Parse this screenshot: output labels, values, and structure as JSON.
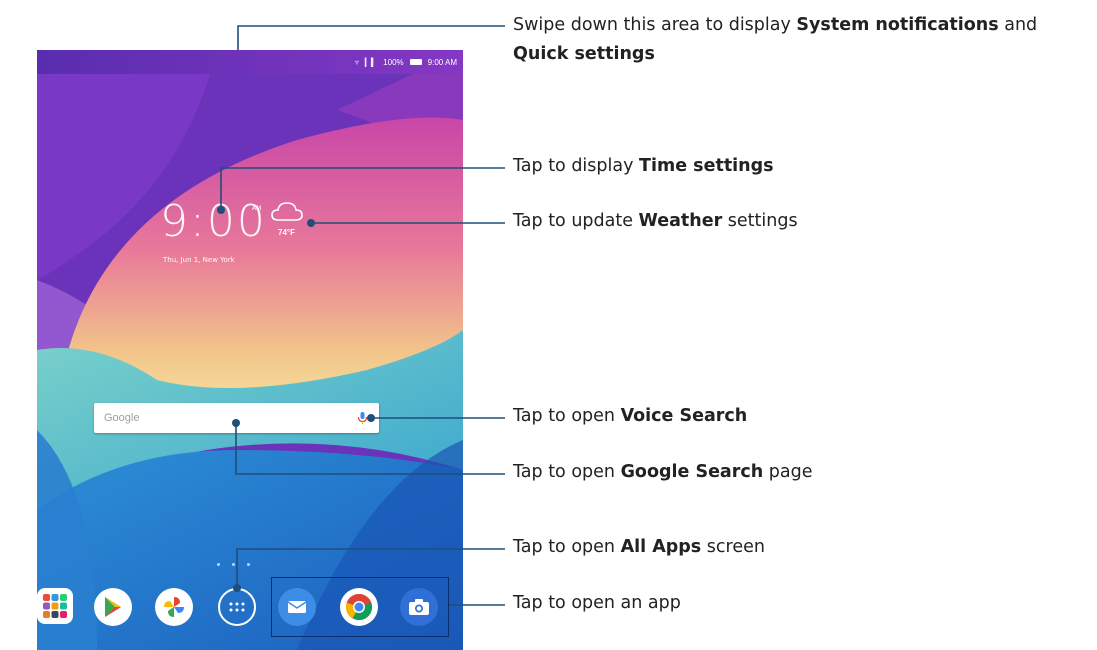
{
  "status_bar": {
    "icons": [
      "wifi-icon",
      "signal-icon",
      "battery-icon"
    ],
    "battery": "100%",
    "time": "9:00 AM"
  },
  "clock_widget": {
    "time": "9:00",
    "ampm": "AM",
    "date": "Thu, Jun 1, New York"
  },
  "weather_widget": {
    "icon": "cloud-icon",
    "temperature": "74°F"
  },
  "search_bar": {
    "logo_text": "Google",
    "mic_icon": "mic-icon"
  },
  "dock": {
    "apps": [
      {
        "name": "apps-folder",
        "icon": "apps-folder-icon"
      },
      {
        "name": "play-store",
        "icon": "play-store-icon"
      },
      {
        "name": "photos",
        "icon": "photos-icon"
      },
      {
        "name": "all-apps",
        "icon": "all-apps-icon"
      },
      {
        "name": "email",
        "icon": "email-icon"
      },
      {
        "name": "chrome",
        "icon": "chrome-icon"
      },
      {
        "name": "camera",
        "icon": "camera-icon"
      }
    ]
  },
  "callouts": [
    {
      "pre": "Swipe down this area to display ",
      "bold": "System notifications",
      "post": " and",
      "line2_bold": "Quick settings"
    },
    {
      "pre": "Tap to display ",
      "bold": "Time settings",
      "post": ""
    },
    {
      "pre": "Tap to update ",
      "bold": "Weather",
      "post": " settings"
    },
    {
      "pre": "Tap to open ",
      "bold": "Voice Search",
      "post": ""
    },
    {
      "pre": "Tap to open ",
      "bold": "Google Search",
      "post": " page"
    },
    {
      "pre": "Tap to open ",
      "bold": "All Apps",
      "post": " screen"
    },
    {
      "pre": "Tap to open an app",
      "bold": "",
      "post": ""
    }
  ],
  "colors": {
    "callout_line": "#1f4e79",
    "accent_blue": "#1e63c6"
  }
}
